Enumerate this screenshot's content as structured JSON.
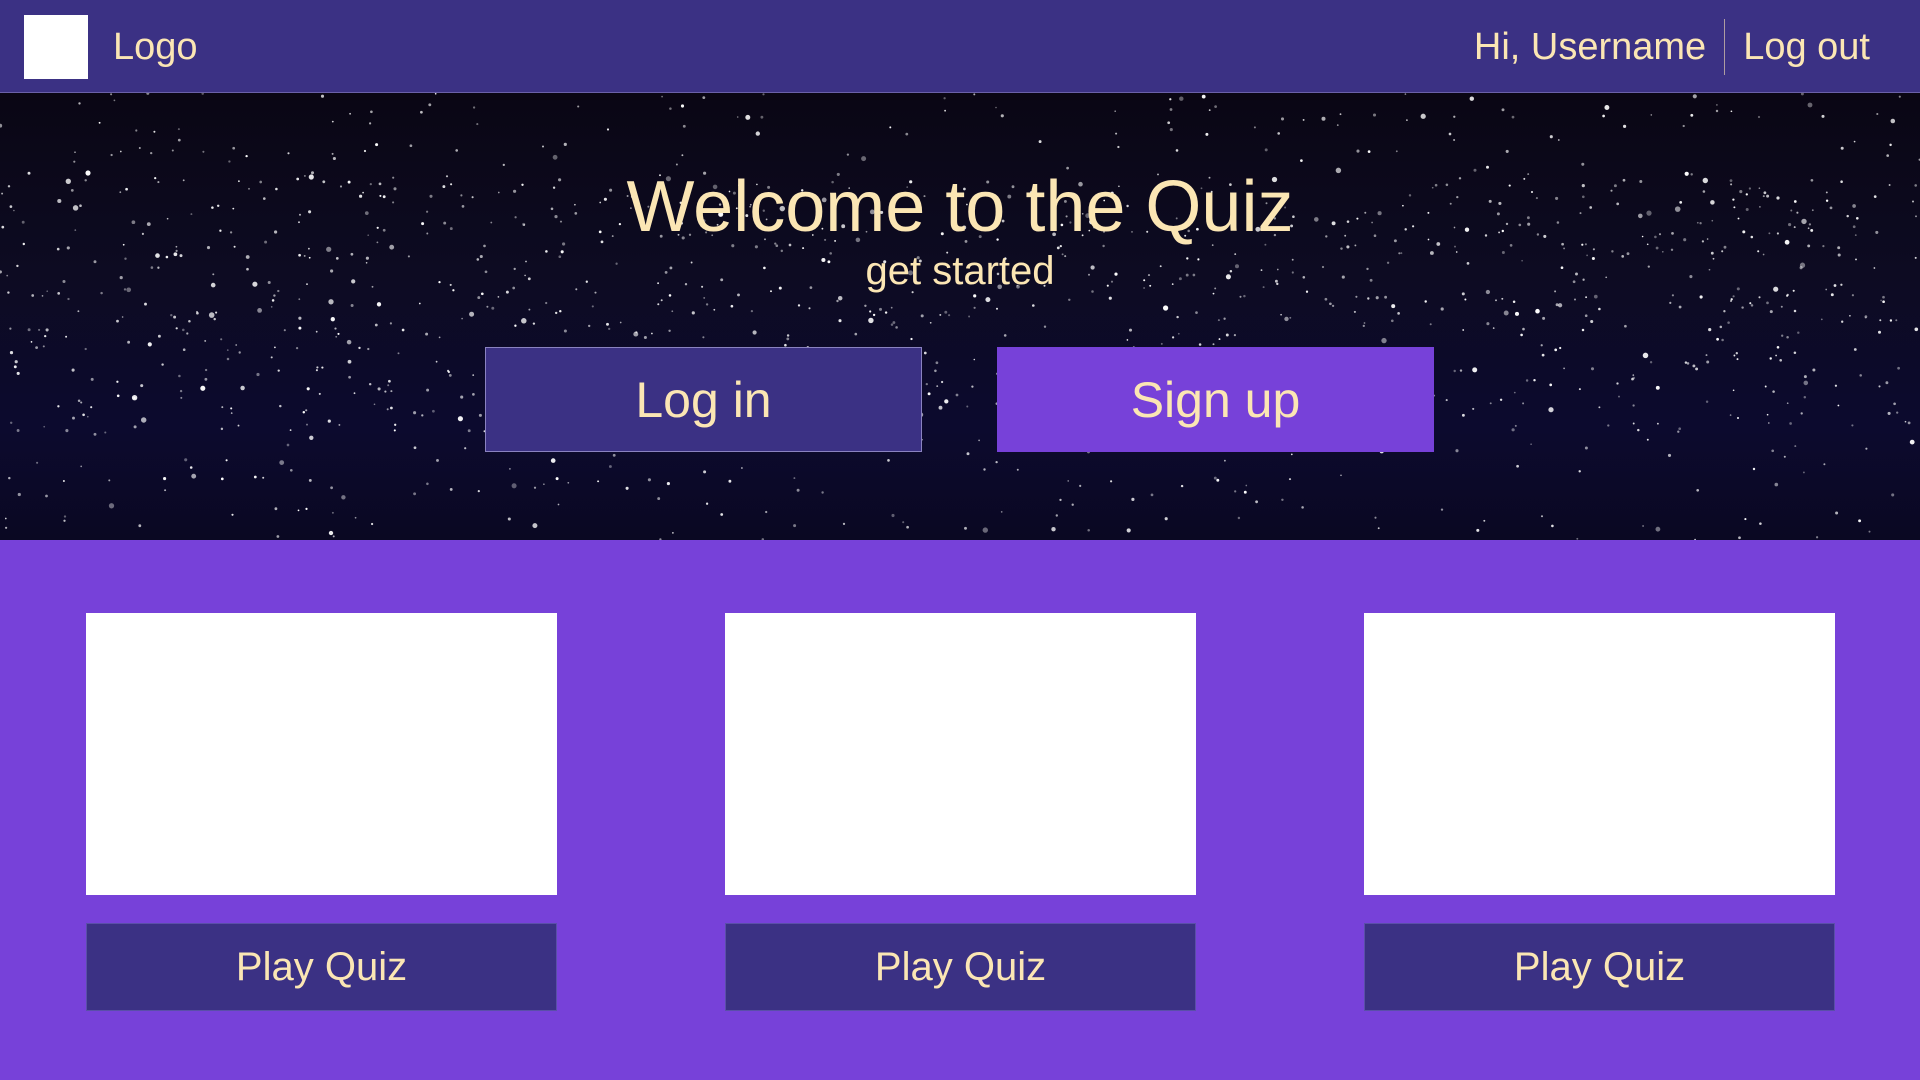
{
  "navbar": {
    "logo_label": "Logo",
    "greeting": "Hi, Username",
    "logout_label": "Log out"
  },
  "hero": {
    "title": "Welcome to the Quiz",
    "subtitle": "get started",
    "login_label": "Log in",
    "signup_label": "Sign up"
  },
  "quizzes": [
    {
      "play_label": "Play Quiz"
    },
    {
      "play_label": "Play Quiz"
    },
    {
      "play_label": "Play Quiz"
    }
  ],
  "colors": {
    "navbar": "#3b3184",
    "accent_purple": "#7741d9",
    "text_cream": "#fbe6b4",
    "card": "#ffffff"
  }
}
